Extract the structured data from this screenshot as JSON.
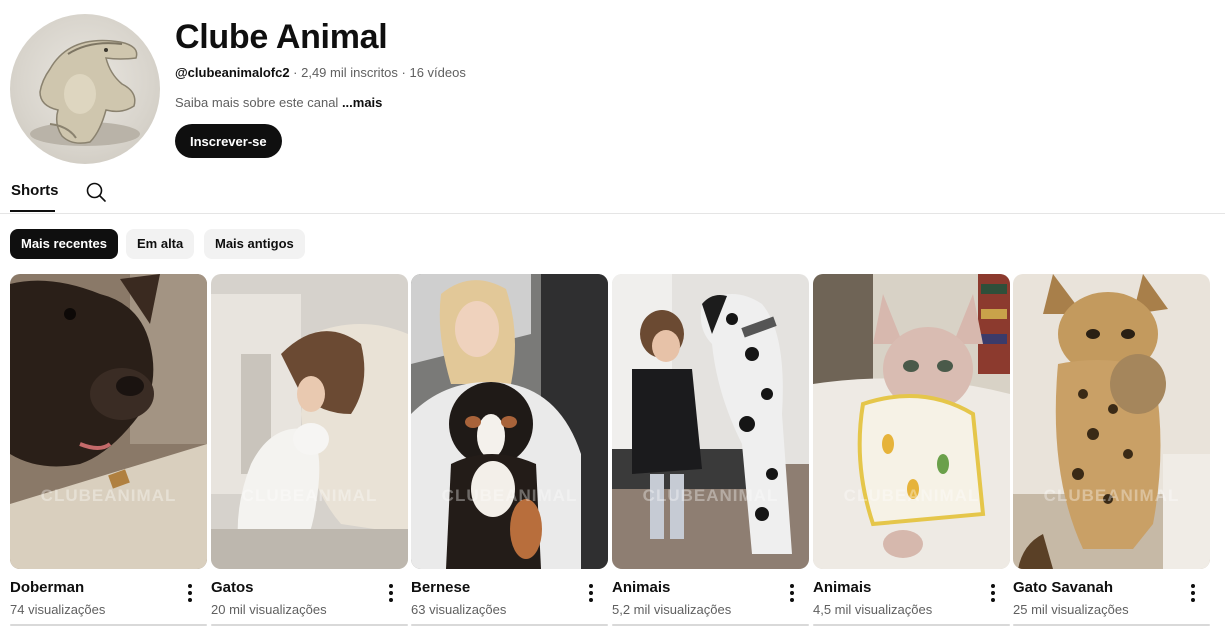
{
  "channel": {
    "name": "Clube Animal",
    "handle": "@clubeanimalofc2",
    "stats": " · 2,49 mil inscritos · 16 vídeos",
    "about": "Saiba mais sobre este canal ",
    "more_label": "...mais",
    "subscribe_label": "Inscrever-se"
  },
  "tabs": {
    "shorts_label": "Shorts"
  },
  "filters": [
    {
      "label": "Mais recentes",
      "active": true
    },
    {
      "label": "Em alta",
      "active": false
    },
    {
      "label": "Mais antigos",
      "active": false
    }
  ],
  "shorts": [
    {
      "title": "Doberman",
      "views": "74 visualizações",
      "watermark": "CLUBEANIMAL"
    },
    {
      "title": "Gatos",
      "views": "20 mil visualizações",
      "watermark": "CLUBEANIMAL"
    },
    {
      "title": "Bernese",
      "views": "63 visualizações",
      "watermark": "CLUBEANIMAL"
    },
    {
      "title": "Animais",
      "views": "5,2 mil visualizações",
      "watermark": "CLUBEANIMAL"
    },
    {
      "title": "Animais",
      "views": "4,5 mil visualizações",
      "watermark": "CLUBEANIMAL"
    },
    {
      "title": "Gato Savanah",
      "views": "25 mil visualizações",
      "watermark": "CLUBEANIMAL"
    }
  ],
  "colors": {
    "text": "#0f0f0f",
    "secondary": "#606060",
    "chip_bg": "#f2f2f2",
    "button_bg": "#0f0f0f"
  },
  "icons": {
    "search": "search-icon",
    "more": "more-vert-icon"
  }
}
